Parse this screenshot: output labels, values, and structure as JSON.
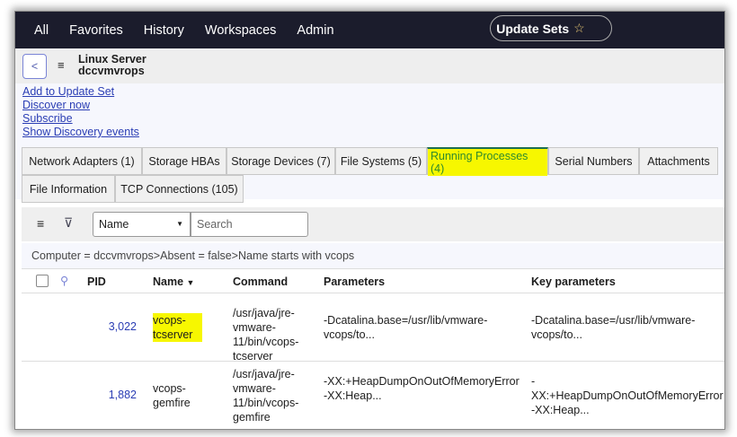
{
  "nav": {
    "items": [
      "All",
      "Favorites",
      "History",
      "Workspaces",
      "Admin"
    ],
    "update_sets": "Update Sets"
  },
  "header": {
    "table": "Linux Server",
    "record": "dccvmvrops"
  },
  "links": [
    "Add to Update Set",
    "Discover now",
    "Subscribe",
    "Show Discovery events"
  ],
  "tabs": [
    "Network Adapters (1)",
    "Storage HBAs",
    "Storage Devices (7)",
    "File Systems (5)",
    "Running Processes (4)",
    "Serial Numbers",
    "Attachments",
    "File Information",
    "TCP Connections (105)"
  ],
  "toolbar": {
    "field": "Name",
    "search_placeholder": "Search"
  },
  "breadcrumb": "Computer = dccvmvrops>Absent = false>Name starts with vcops",
  "columns": {
    "pid": "PID",
    "name": "Name",
    "command": "Command",
    "parameters": "Parameters",
    "key": "Key parameters"
  },
  "rows": [
    {
      "pid": "3,022",
      "name": "vcops-tcserver",
      "command": "/usr/java/jre-vmware-11/bin/vcops-tcserver",
      "parameters": "-Dcatalina.base=/usr/lib/vmware-vcops/to...",
      "key": "-Dcatalina.base=/usr/lib/vmware-vcops/to..."
    },
    {
      "pid": "1,882",
      "name": "vcops-gemfire",
      "command": "/usr/java/jre-vmware-11/bin/vcops-gemfire",
      "parameters": "-XX:+HeapDumpOnOutOfMemoryError -XX:Heap...",
      "key": "-XX:+HeapDumpOnOutOfMemoryError -XX:Heap..."
    }
  ]
}
